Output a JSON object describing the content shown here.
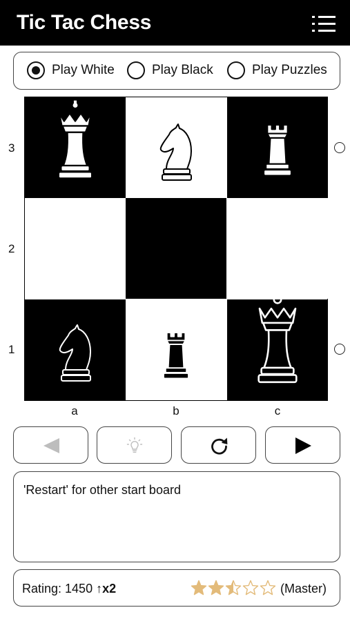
{
  "header": {
    "title": "Tic Tac Chess",
    "menu_icon": "hamburger-menu-icon"
  },
  "mode_selector": {
    "options": [
      {
        "label": "Play White",
        "selected": true
      },
      {
        "label": "Play Black",
        "selected": false
      },
      {
        "label": "Play Puzzles",
        "selected": false
      }
    ]
  },
  "board": {
    "files": [
      "a",
      "b",
      "c"
    ],
    "ranks": [
      "3",
      "2",
      "1"
    ],
    "squares": [
      [
        "dark",
        "light",
        "dark"
      ],
      [
        "light",
        "dark",
        "light"
      ],
      [
        "dark",
        "light",
        "dark"
      ]
    ],
    "pieces": [
      {
        "square": "a3",
        "type": "queen",
        "color": "white"
      },
      {
        "square": "b3",
        "type": "knight",
        "color": "white"
      },
      {
        "square": "c3",
        "type": "rook",
        "color": "white"
      },
      {
        "square": "a1",
        "type": "knight",
        "color": "black"
      },
      {
        "square": "b1",
        "type": "rook",
        "color": "black"
      },
      {
        "square": "c1",
        "type": "queen",
        "color": "black"
      }
    ],
    "row_markers": [
      "3",
      "1"
    ]
  },
  "controls": [
    {
      "name": "back-button",
      "icon": "triangle-left-icon",
      "enabled": false
    },
    {
      "name": "hint-button",
      "icon": "lightbulb-icon",
      "enabled": false
    },
    {
      "name": "restart-button",
      "icon": "restart-icon",
      "enabled": true
    },
    {
      "name": "forward-button",
      "icon": "triangle-right-icon",
      "enabled": true
    }
  ],
  "message": {
    "text": "'Restart' for other start board"
  },
  "rating": {
    "label": "Rating: 1450",
    "multiplier": "↑x2",
    "stars": 2.5,
    "max_stars": 5,
    "rank": "(Master)",
    "star_color": "#E3BB7A"
  },
  "colors": {
    "header_bg": "#000000",
    "dark_square": "#000000",
    "light_square": "#FFFFFF",
    "disabled_icon": "#BDBDBD"
  }
}
